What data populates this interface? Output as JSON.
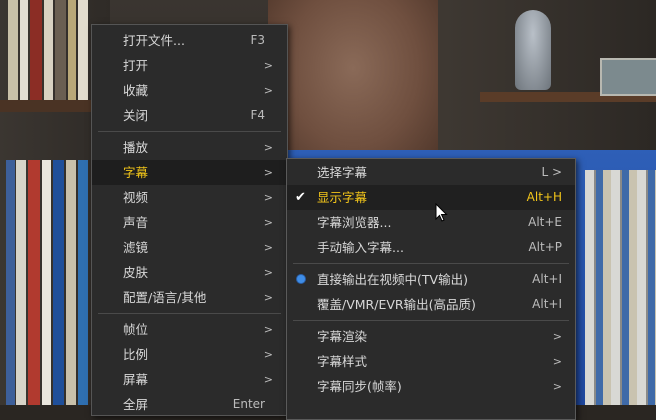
{
  "main_menu": {
    "items": [
      {
        "label": "打开文件...",
        "key": "F3"
      },
      {
        "label": "打开",
        "arrow": ">"
      },
      {
        "label": "收藏",
        "arrow": ">"
      },
      {
        "label": "关闭",
        "key": "F4"
      },
      {
        "label": "播放",
        "arrow": ">"
      },
      {
        "label": "字幕",
        "arrow": ">"
      },
      {
        "label": "视频",
        "arrow": ">"
      },
      {
        "label": "声音",
        "arrow": ">"
      },
      {
        "label": "滤镜",
        "arrow": ">"
      },
      {
        "label": "皮肤",
        "arrow": ">"
      },
      {
        "label": "配置/语言/其他",
        "arrow": ">"
      },
      {
        "label": "帧位",
        "arrow": ">"
      },
      {
        "label": "比例",
        "arrow": ">"
      },
      {
        "label": "屏幕",
        "arrow": ">"
      },
      {
        "label": "全屏",
        "key": "Enter"
      }
    ]
  },
  "subtitle_menu": {
    "items": [
      {
        "label": "选择字幕",
        "key": "L >"
      },
      {
        "label": "显示字幕",
        "key": "Alt+H"
      },
      {
        "label": "字幕浏览器...",
        "key": "Alt+E"
      },
      {
        "label": "手动输入字幕...",
        "key": "Alt+P"
      },
      {
        "label": "直接输出在视频中(TV输出)",
        "key": "Alt+I"
      },
      {
        "label": "覆盖/VMR/EVR输出(高品质)",
        "key": "Alt+I"
      },
      {
        "label": "字幕渲染",
        "arrow": ">"
      },
      {
        "label": "字幕样式",
        "arrow": ">"
      },
      {
        "label": "字幕同步(帧率)",
        "arrow": ">"
      }
    ]
  },
  "colors": {
    "highlight_text": "#f2c51a",
    "radio_selected": "#3f8de6",
    "menu_bg": "#2b2b2b"
  },
  "icons": {
    "check": "check-icon",
    "radio": "radio-selected-icon",
    "arrow": "chevron-right-icon",
    "cursor": "mouse-cursor-icon"
  }
}
